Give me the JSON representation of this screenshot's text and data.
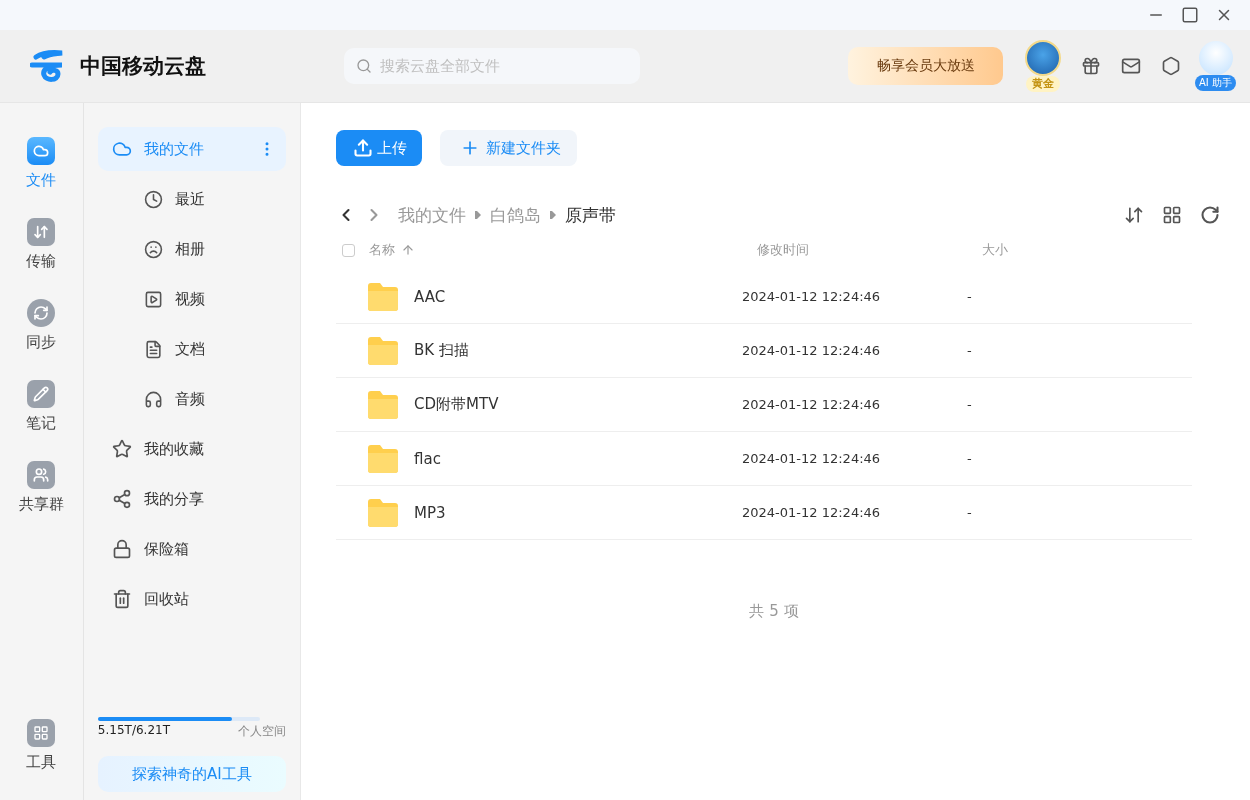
{
  "header": {
    "app_name": "中国移动云盘",
    "search": {
      "placeholder": "搜索云盘全部文件"
    },
    "promo": "畅享会员大放送",
    "avatar_badge": "黄金",
    "assistant_label": "AI 助手"
  },
  "rail": {
    "items": [
      {
        "label": "文件",
        "selected": true
      },
      {
        "label": "传输",
        "selected": false
      },
      {
        "label": "同步",
        "selected": false
      },
      {
        "label": "笔记",
        "selected": false
      },
      {
        "label": "共享群",
        "selected": false
      }
    ],
    "tools": {
      "label": "工具",
      "selected": false
    }
  },
  "nav": {
    "items": [
      {
        "label": "我的文件",
        "selected": true,
        "children": [
          {
            "label": "最近",
            "selected": false
          },
          {
            "label": "相册",
            "selected": false
          },
          {
            "label": "视频",
            "selected": false
          },
          {
            "label": "文档",
            "selected": false
          },
          {
            "label": "音频",
            "selected": false
          }
        ]
      },
      {
        "label": "我的收藏",
        "selected": false
      },
      {
        "label": "我的分享",
        "selected": false
      },
      {
        "label": "保险箱",
        "selected": false
      },
      {
        "label": "回收站",
        "selected": false
      }
    ],
    "storage": {
      "used": "5.15T/6.21T",
      "label": "个人空间",
      "level": 0.83
    },
    "ai_tools": "探索神奇的AI工具"
  },
  "toolbar": {
    "upload": "上传",
    "new_folder": "新建文件夹"
  },
  "breadcrumb": [
    "我的文件",
    "白鸽岛",
    "原声带"
  ],
  "table": {
    "select_all": {
      "checked": false
    },
    "columns": [
      "名称",
      "修改时间",
      "大小"
    ],
    "sort_ascending": true,
    "rows": [
      {
        "name": "AAC",
        "modified": "2024-01-12 12:24:46",
        "size": "-"
      },
      {
        "name": "BK 扫描",
        "modified": "2024-01-12 12:24:46",
        "size": "-"
      },
      {
        "name": "CD附带MTV",
        "modified": "2024-01-12 12:24:46",
        "size": "-"
      },
      {
        "name": "flac",
        "modified": "2024-01-12 12:24:46",
        "size": "-"
      },
      {
        "name": "MP3",
        "modified": "2024-01-12 12:24:46",
        "size": "-"
      }
    ]
  },
  "footer": "共 5 项"
}
